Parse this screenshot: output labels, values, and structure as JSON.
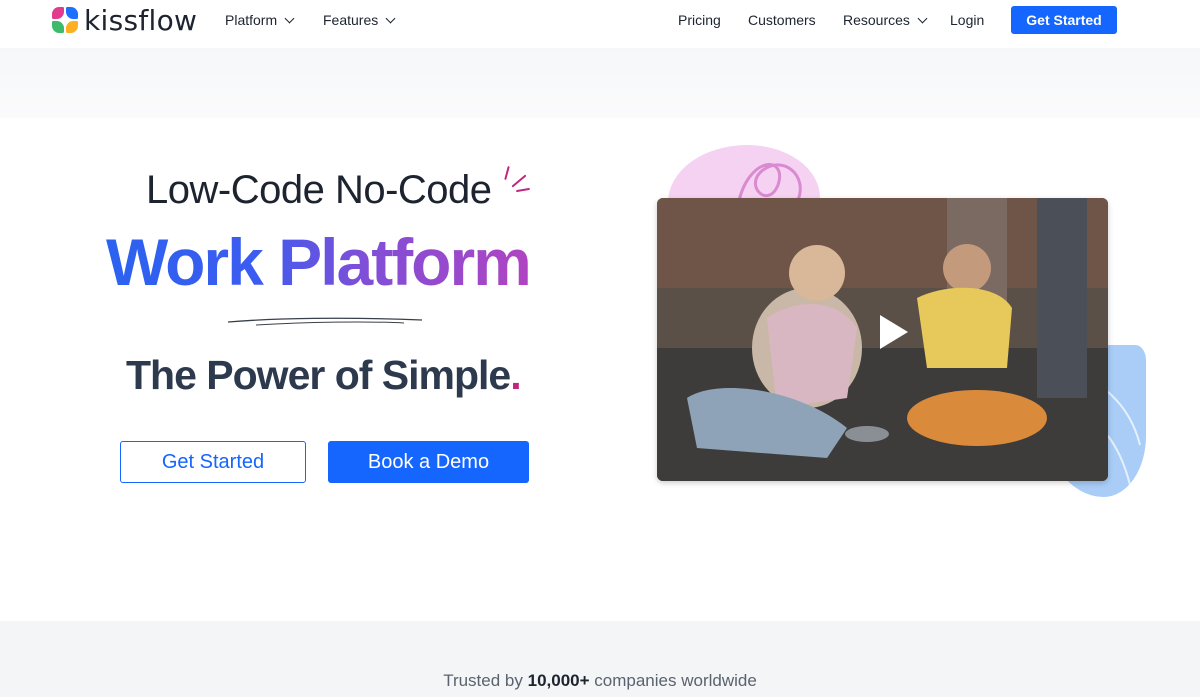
{
  "nav": {
    "brand": "kissflow",
    "items": [
      {
        "label": "Platform"
      },
      {
        "label": "Features"
      },
      {
        "label": "Pricing"
      },
      {
        "label": "Customers"
      },
      {
        "label": "Resources"
      },
      {
        "label": "Login"
      }
    ],
    "cta_label": "Get Started"
  },
  "hero": {
    "eyebrow": "Low-Code No-Code",
    "headline": "Work Platform",
    "tagline": "The Power of Simple",
    "tagline_dot": ".",
    "primary_button": "Get Started",
    "secondary_button": "Book a Demo",
    "video": {
      "icon": "play-icon"
    }
  },
  "trusted": {
    "prefix": "Trusted by",
    "count": "10,000+",
    "suffix": "companies worldwide"
  },
  "colors": {
    "brand_blue": "#1565ff",
    "accent_magenta": "#c0267f",
    "headline_gradient": [
      "#2c62f0",
      "#b044c2"
    ]
  }
}
